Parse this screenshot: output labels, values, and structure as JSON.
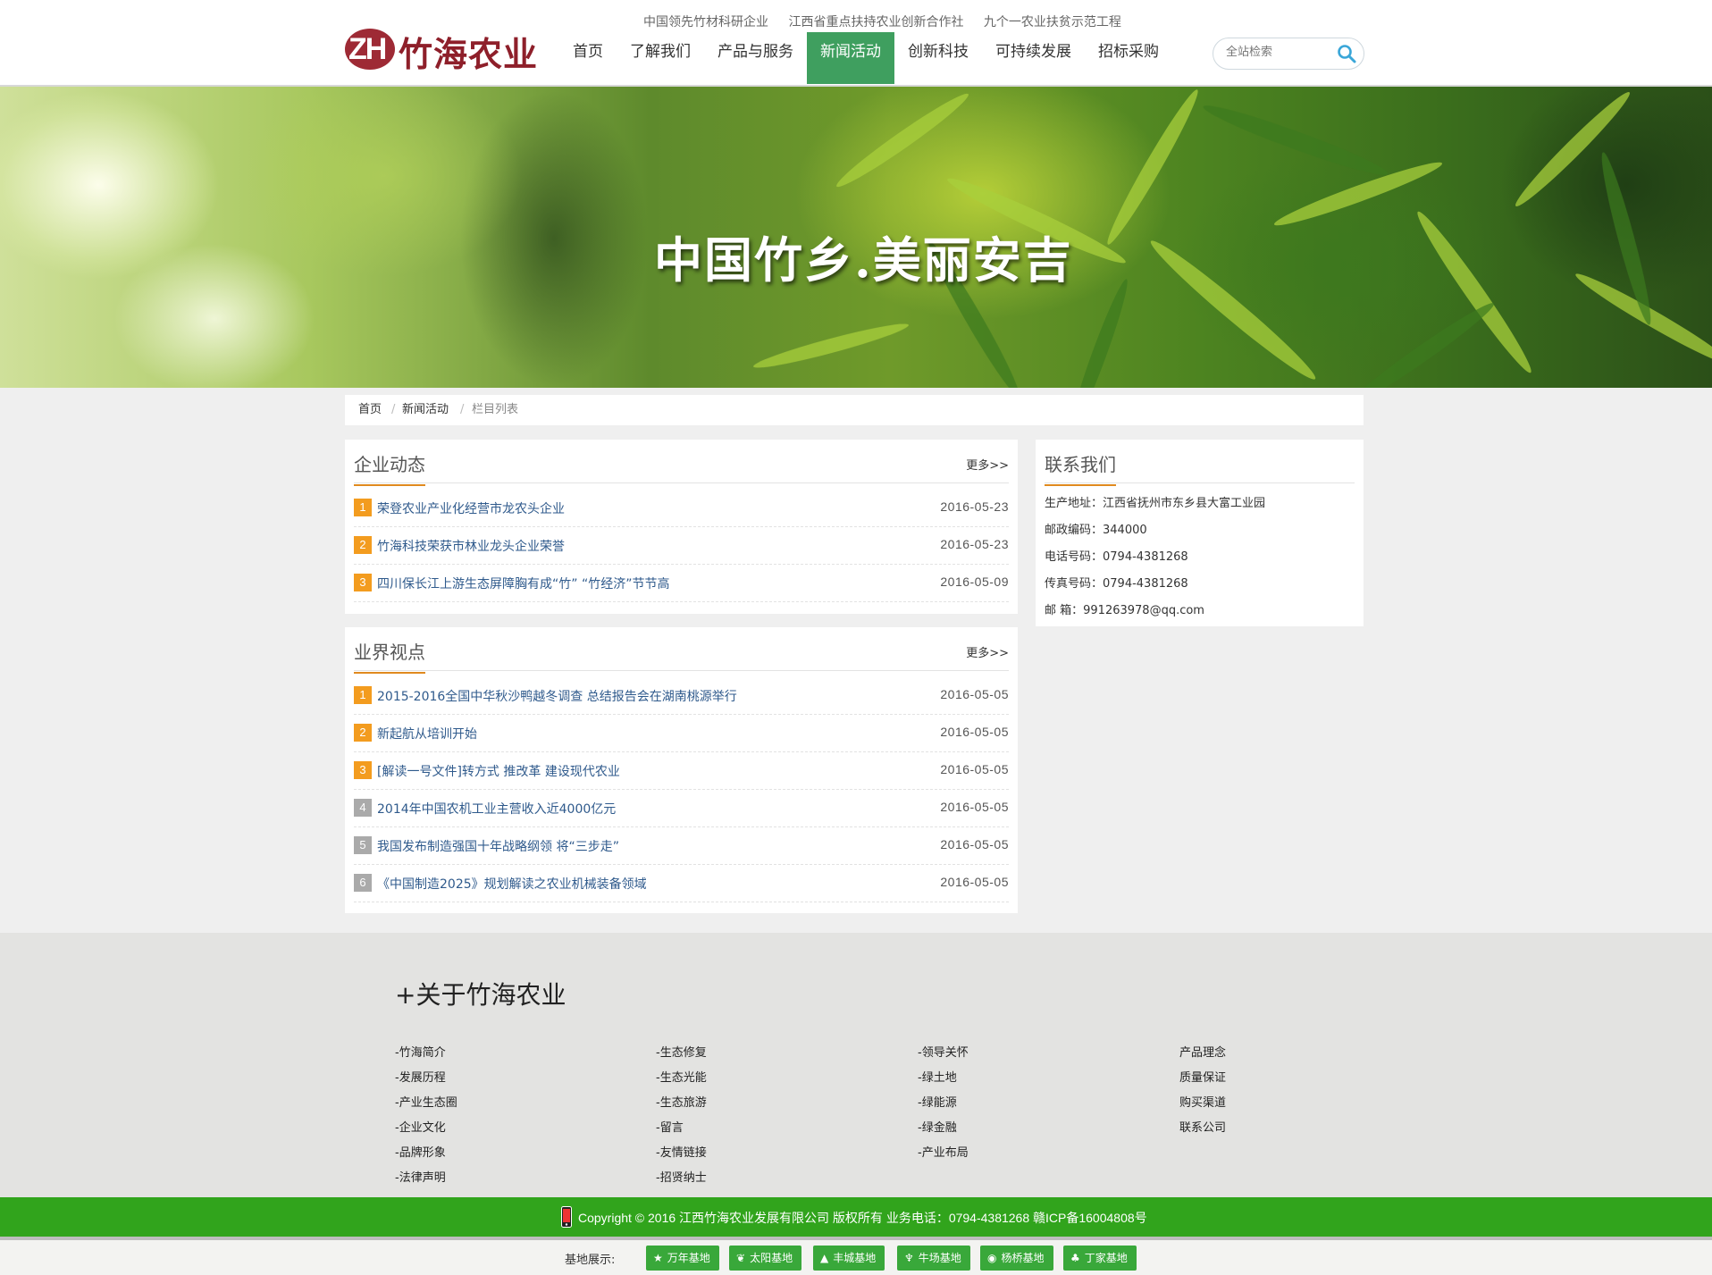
{
  "header": {
    "logo_mark": "ZH",
    "logo_text": "竹海农业",
    "slogans": [
      "中国领先竹材科研企业",
      "江西省重点扶持农业创新合作社",
      "九个一农业扶贫示范工程"
    ],
    "nav": [
      "首页",
      "了解我们",
      "产品与服务",
      "新闻活动",
      "创新科技",
      "可持续发展",
      "招标采购"
    ],
    "nav_active": "新闻活动",
    "search_placeholder": "全站检索"
  },
  "banner": {
    "title": "中国竹乡.美丽安吉"
  },
  "breadcrumb": {
    "items": [
      "首页",
      "新闻活动",
      "栏目列表"
    ],
    "separator": "/"
  },
  "company_news": {
    "title": "企业动态",
    "more": "更多>>",
    "items": [
      {
        "num": "1",
        "title": "荣登农业产业化经营市龙农头企业",
        "date": "2016-05-23"
      },
      {
        "num": "2",
        "title": "竹海科技荣获市林业龙头企业荣誉",
        "date": "2016-05-23"
      },
      {
        "num": "3",
        "title": "四川保长江上游生态屏障胸有成“竹”  “竹经济”节节高",
        "date": "2016-05-09"
      }
    ]
  },
  "industry_view": {
    "title": "业界视点",
    "more": "更多>>",
    "items": [
      {
        "num": "1",
        "title": "2015-2016全国中华秋沙鸭越冬调查 总结报告会在湖南桃源举行",
        "date": "2016-05-05"
      },
      {
        "num": "2",
        "title": "新起航从培训开始",
        "date": "2016-05-05"
      },
      {
        "num": "3",
        "title": "[解读一号文件]转方式 推改革 建设现代农业",
        "date": "2016-05-05"
      },
      {
        "num": "4",
        "title": "2014年中国农机工业主营收入近4000亿元",
        "date": "2016-05-05"
      },
      {
        "num": "5",
        "title": "我国发布制造强国十年战略纲领 将“三步走”",
        "date": "2016-05-05"
      },
      {
        "num": "6",
        "title": "《中国制造2025》规划解读之农业机械装备领域",
        "date": "2016-05-05"
      }
    ]
  },
  "contact": {
    "title": "联系我们",
    "rows": [
      "生产地址：江西省抚州市东乡县大富工业园",
      "邮政编码：344000",
      "电话号码：0794-4381268",
      "传真号码：0794-4381268",
      "邮  箱：991263978@qq.com"
    ]
  },
  "footer": {
    "heading": "+关于竹海农业",
    "columns": [
      [
        "-竹海简介",
        "-发展历程",
        "-产业生态圈",
        "-企业文化",
        "-品牌形象",
        "-法律声明"
      ],
      [
        "-生态修复",
        "-生态光能",
        "-生态旅游",
        "-留言",
        "-友情链接",
        "-招贤纳士"
      ],
      [
        "-领导关怀",
        "-绿土地",
        "-绿能源",
        "-绿金融",
        "-产业布局"
      ],
      [
        "产品理念",
        "质量保证",
        "购买渠道",
        "联系公司"
      ]
    ],
    "copyright": "Copyright © 2016 江西竹海农业发展有限公司 版权所有 业务电话：0794-4381268 赣ICP备16004808号",
    "bases_label": "基地展示:",
    "bases": [
      {
        "icon": "star-icon",
        "label": "万年基地"
      },
      {
        "icon": "leaf-icon",
        "label": "太阳基地"
      },
      {
        "icon": "bell-icon",
        "label": "丰城基地"
      },
      {
        "icon": "wheat-icon",
        "label": "牛场基地"
      },
      {
        "icon": "ball-icon",
        "label": "杨桥基地"
      },
      {
        "icon": "tree-icon",
        "label": "丁家基地"
      }
    ]
  },
  "colors": {
    "nav_active": "#3f9f5f",
    "accent_orange": "#f39c1f",
    "link_blue": "#2f5a8c",
    "copyright_green": "#31a41c",
    "logo_red": "#8e1f2a"
  }
}
